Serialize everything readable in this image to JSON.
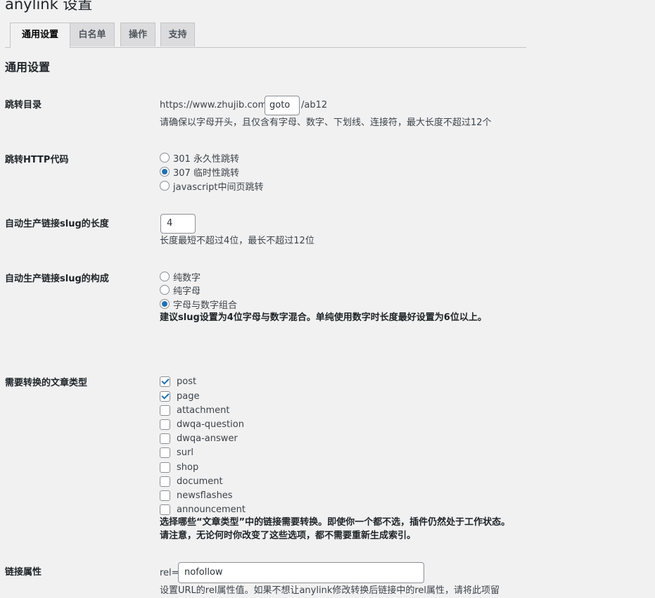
{
  "page": {
    "title": "anylink 设置"
  },
  "tabs": [
    {
      "label": "通用设置",
      "active": true
    },
    {
      "label": "白名单",
      "active": false
    },
    {
      "label": "操作",
      "active": false
    },
    {
      "label": "支持",
      "active": false
    }
  ],
  "section_title": "通用设置",
  "redirect_dir": {
    "label": "跳转目录",
    "prefix": "https://www.zhujib.com/",
    "value": "goto",
    "suffix": "/ab12",
    "description": "请确保以字母开头，且仅含有字母、数字、下划线、连接符，最大长度不超过12个"
  },
  "http_code": {
    "label": "跳转HTTP代码",
    "options": [
      {
        "label": "301 永久性跳转",
        "checked": false
      },
      {
        "label": "307 临时性跳转",
        "checked": true
      },
      {
        "label": "javascript中间页跳转",
        "checked": false
      }
    ]
  },
  "slug_length": {
    "label": "自动生产链接slug的长度",
    "value": "4",
    "description": "长度最短不超过4位，最长不超过12位"
  },
  "slug_composition": {
    "label": "自动生产链接slug的构成",
    "options": [
      {
        "label": "纯数字",
        "checked": false
      },
      {
        "label": "纯字母",
        "checked": false
      },
      {
        "label": "字母与数字组合",
        "checked": true
      }
    ],
    "description": "建议slug设置为4位字母与数字混合。单纯使用数字时长度最好设置为6位以上。"
  },
  "post_types": {
    "label": "需要转换的文章类型",
    "options": [
      {
        "label": "post",
        "checked": true
      },
      {
        "label": "page",
        "checked": true
      },
      {
        "label": "attachment",
        "checked": false
      },
      {
        "label": "dwqa-question",
        "checked": false
      },
      {
        "label": "dwqa-answer",
        "checked": false
      },
      {
        "label": "surl",
        "checked": false
      },
      {
        "label": "shop",
        "checked": false
      },
      {
        "label": "document",
        "checked": false
      },
      {
        "label": "newsflashes",
        "checked": false
      },
      {
        "label": "announcement",
        "checked": false
      }
    ],
    "description": "选择哪些“文章类型”中的链接需要转换。即使你一个都不选，插件仍然处于工作状态。请注意，无论何时你改变了这些选项，都不需要重新生成索引。"
  },
  "rel_attr": {
    "label": "链接属性",
    "prefix": "rel=",
    "value": "nofollow",
    "description": "设置URL的rel属性值。如果不想让anylink修改转换后链接中的rel属性，请将此项留"
  }
}
